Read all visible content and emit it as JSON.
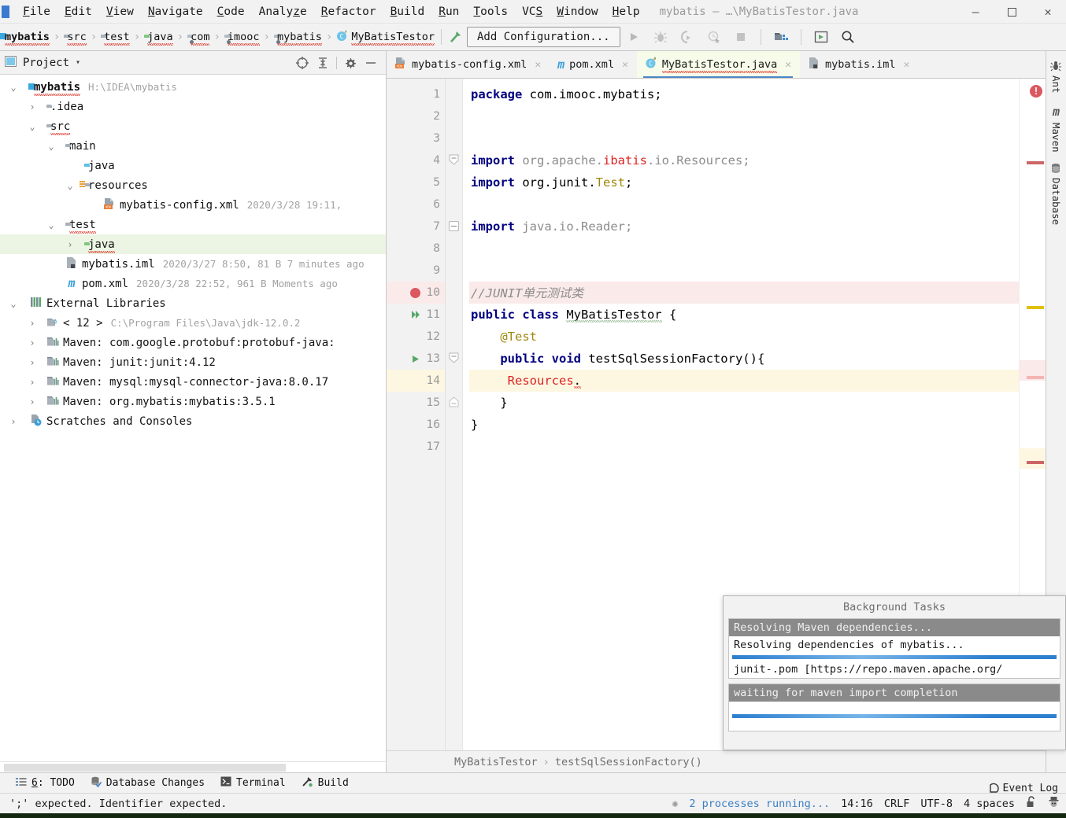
{
  "window": {
    "title": "mybatis – …\\MyBatisTestor.java",
    "minimize": "–",
    "maximize": "▢",
    "close": "✕"
  },
  "menubar": {
    "items": [
      {
        "label": "File",
        "mnemonic": "F"
      },
      {
        "label": "Edit",
        "mnemonic": "E"
      },
      {
        "label": "View",
        "mnemonic": "V"
      },
      {
        "label": "Navigate",
        "mnemonic": "N"
      },
      {
        "label": "Code",
        "mnemonic": "C"
      },
      {
        "label": "Analyze",
        "mnemonic": "z"
      },
      {
        "label": "Refactor",
        "mnemonic": "R"
      },
      {
        "label": "Build",
        "mnemonic": "B"
      },
      {
        "label": "Run",
        "mnemonic": "R"
      },
      {
        "label": "Tools",
        "mnemonic": "T"
      },
      {
        "label": "VCS",
        "mnemonic": "S"
      },
      {
        "label": "Window",
        "mnemonic": "W"
      },
      {
        "label": "Help",
        "mnemonic": "H"
      }
    ]
  },
  "navbar": {
    "breadcrumbs": [
      {
        "label": "mybatis",
        "icon": "module-folder-icon",
        "bold": true
      },
      {
        "label": "src",
        "icon": "folder-icon",
        "bold": false
      },
      {
        "label": "test",
        "icon": "folder-icon",
        "bold": false
      },
      {
        "label": "java",
        "icon": "source-folder-icon",
        "bold": false
      },
      {
        "label": "com",
        "icon": "package-icon",
        "bold": false
      },
      {
        "label": "imooc",
        "icon": "package-icon",
        "bold": false
      },
      {
        "label": "mybatis",
        "icon": "package-icon",
        "bold": false
      },
      {
        "label": "MyBatisTestor",
        "icon": "java-class-icon",
        "bold": false
      }
    ],
    "separator": "›",
    "add_configuration": "Add Configuration...",
    "buttons": [
      {
        "name": "build-hammer-icon",
        "title": "Build"
      },
      {
        "name": "run-icon",
        "title": "Run"
      },
      {
        "name": "debug-icon",
        "title": "Debug"
      },
      {
        "name": "run-with-coverage-icon",
        "title": "Run with Coverage"
      },
      {
        "name": "profile-icon",
        "title": "Profile"
      },
      {
        "name": "stop-icon",
        "title": "Stop"
      },
      {
        "name": "project-structure-icon",
        "title": "Project Structure"
      },
      {
        "name": "updates-icon",
        "title": "Updates"
      },
      {
        "name": "search-everywhere-icon",
        "title": "Search Everywhere"
      }
    ]
  },
  "project_panel": {
    "title": "Project",
    "caret": "▾",
    "tools": [
      {
        "name": "select-opened-file-icon"
      },
      {
        "name": "collapse-all-icon"
      },
      {
        "name": "settings-gear-icon"
      },
      {
        "name": "hide-icon"
      }
    ],
    "tree": [
      {
        "indent": 0,
        "arrow": "v",
        "icon": "module-folder-icon",
        "label": "mybatis",
        "bold": true,
        "meta": "H:\\IDEA\\mybatis",
        "selected": false,
        "squiggle": true
      },
      {
        "indent": 1,
        "arrow": ">",
        "icon": "folder-icon",
        "label": ".idea",
        "bold": false,
        "meta": "",
        "selected": false,
        "squiggle": false
      },
      {
        "indent": 1,
        "arrow": "v",
        "icon": "folder-icon",
        "label": "src",
        "bold": false,
        "meta": "",
        "selected": false,
        "squiggle": true
      },
      {
        "indent": 2,
        "arrow": "v",
        "icon": "folder-icon",
        "label": "main",
        "bold": false,
        "meta": "",
        "selected": false,
        "squiggle": false
      },
      {
        "indent": 3,
        "arrow": "",
        "icon": "source-folder-blue-icon",
        "label": "java",
        "bold": false,
        "meta": "",
        "selected": false,
        "squiggle": false
      },
      {
        "indent": 3,
        "arrow": "v",
        "icon": "resources-folder-icon",
        "label": "resources",
        "bold": false,
        "meta": "",
        "selected": false,
        "squiggle": false
      },
      {
        "indent": 4,
        "arrow": "",
        "icon": "xml-file-icon",
        "label": "mybatis-config.xml",
        "bold": false,
        "meta": "2020/3/28 19:11,",
        "selected": false,
        "squiggle": false
      },
      {
        "indent": 2,
        "arrow": "v",
        "icon": "folder-icon",
        "label": "test",
        "bold": false,
        "meta": "",
        "selected": false,
        "squiggle": true
      },
      {
        "indent": 3,
        "arrow": ">",
        "icon": "test-source-folder-icon",
        "label": "java",
        "bold": false,
        "meta": "",
        "selected": true,
        "squiggle": true
      },
      {
        "indent": 2,
        "arrow": "",
        "icon": "iml-file-icon",
        "label": "mybatis.iml",
        "bold": false,
        "meta": "2020/3/27 8:50, 81 B 7 minutes ago",
        "selected": false,
        "squiggle": false
      },
      {
        "indent": 2,
        "arrow": "",
        "icon": "maven-pom-icon",
        "label": "pom.xml",
        "bold": false,
        "meta": "2020/3/28 22:52, 961 B Moments ago",
        "selected": false,
        "squiggle": false
      },
      {
        "indent": 0,
        "arrow": "v",
        "icon": "external-libraries-icon",
        "label": "External Libraries",
        "bold": false,
        "meta": "",
        "selected": false,
        "squiggle": false
      },
      {
        "indent": 1,
        "arrow": ">",
        "icon": "jdk-icon",
        "label": "< 12 >",
        "bold": false,
        "meta": "C:\\Program Files\\Java\\jdk-12.0.2",
        "selected": false,
        "squiggle": false
      },
      {
        "indent": 1,
        "arrow": ">",
        "icon": "library-icon",
        "label": "Maven: com.google.protobuf:protobuf-java:",
        "bold": false,
        "meta": "",
        "selected": false,
        "squiggle": false
      },
      {
        "indent": 1,
        "arrow": ">",
        "icon": "library-icon",
        "label": "Maven: junit:junit:4.12",
        "bold": false,
        "meta": "",
        "selected": false,
        "squiggle": false
      },
      {
        "indent": 1,
        "arrow": ">",
        "icon": "library-icon",
        "label": "Maven: mysql:mysql-connector-java:8.0.17",
        "bold": false,
        "meta": "",
        "selected": false,
        "squiggle": false
      },
      {
        "indent": 1,
        "arrow": ">",
        "icon": "library-icon",
        "label": "Maven: org.mybatis:mybatis:3.5.1",
        "bold": false,
        "meta": "",
        "selected": false,
        "squiggle": false
      },
      {
        "indent": 0,
        "arrow": ">",
        "icon": "scratches-icon",
        "label": "Scratches and Consoles",
        "bold": false,
        "meta": "",
        "selected": false,
        "squiggle": false
      }
    ]
  },
  "editor": {
    "tabs": [
      {
        "label": "mybatis-config.xml",
        "icon": "xml-file-icon",
        "active": false,
        "close": "✕"
      },
      {
        "label": "pom.xml",
        "icon": "maven-pom-icon",
        "active": false,
        "close": "✕"
      },
      {
        "label": "MyBatisTestor.java",
        "icon": "java-class-icon",
        "active": true,
        "close": "✕"
      },
      {
        "label": "mybatis.iml",
        "icon": "iml-file-icon",
        "active": false,
        "close": "✕"
      }
    ],
    "lines": [
      {
        "n": 1,
        "state": "",
        "gutter": "",
        "fold": "",
        "tokens": [
          {
            "t": "package",
            "c": "kw"
          },
          {
            "t": " ",
            "c": "pl"
          },
          {
            "t": "com.imooc.mybatis;",
            "c": "pl"
          }
        ]
      },
      {
        "n": 2,
        "state": "",
        "gutter": "",
        "fold": "",
        "tokens": []
      },
      {
        "n": 3,
        "state": "",
        "gutter": "",
        "fold": "",
        "tokens": []
      },
      {
        "n": 4,
        "state": "",
        "gutter": "",
        "fold": "fold-down",
        "tokens": [
          {
            "t": "import",
            "c": "kw"
          },
          {
            "t": " ",
            "c": "pl"
          },
          {
            "t": "org.apache.",
            "c": "gray"
          },
          {
            "t": "ibatis",
            "c": "red"
          },
          {
            "t": ".io.Resources;",
            "c": "gray"
          }
        ]
      },
      {
        "n": 5,
        "state": "",
        "gutter": "",
        "fold": "",
        "tokens": [
          {
            "t": "import",
            "c": "kw"
          },
          {
            "t": " ",
            "c": "pl"
          },
          {
            "t": "org.junit.",
            "c": "pl"
          },
          {
            "t": "Test",
            "c": "annot"
          },
          {
            "t": ";",
            "c": "pl"
          }
        ]
      },
      {
        "n": 6,
        "state": "",
        "gutter": "",
        "fold": "",
        "tokens": []
      },
      {
        "n": 7,
        "state": "",
        "gutter": "",
        "fold": "fold-minus",
        "tokens": [
          {
            "t": "import",
            "c": "kw"
          },
          {
            "t": " ",
            "c": "pl"
          },
          {
            "t": "java.io.Reader;",
            "c": "gray"
          }
        ]
      },
      {
        "n": 8,
        "state": "",
        "gutter": "",
        "fold": "",
        "tokens": []
      },
      {
        "n": 9,
        "state": "",
        "gutter": "",
        "fold": "",
        "tokens": []
      },
      {
        "n": 10,
        "state": "err",
        "gutter": "breakpoint",
        "fold": "",
        "tokens": [
          {
            "t": "//JUNIT单元测试类",
            "c": "cmt"
          }
        ]
      },
      {
        "n": 11,
        "state": "",
        "gutter": "run-all",
        "fold": "",
        "tokens": [
          {
            "t": "public",
            "c": "kw"
          },
          {
            "t": " ",
            "c": "pl"
          },
          {
            "t": "class",
            "c": "kw"
          },
          {
            "t": " ",
            "c": "pl"
          },
          {
            "t": "MyBatisTestor",
            "c": "clserr"
          },
          {
            "t": " {",
            "c": "pl"
          }
        ]
      },
      {
        "n": 12,
        "state": "",
        "gutter": "",
        "fold": "",
        "tokens": [
          {
            "t": "    ",
            "c": "pl"
          },
          {
            "t": "@Test",
            "c": "annot"
          }
        ]
      },
      {
        "n": 13,
        "state": "",
        "gutter": "run",
        "fold": "fold-minus",
        "tokens": [
          {
            "t": "    ",
            "c": "pl"
          },
          {
            "t": "public",
            "c": "kw"
          },
          {
            "t": " ",
            "c": "pl"
          },
          {
            "t": "void",
            "c": "kw"
          },
          {
            "t": " testSqlSessionFactory(){",
            "c": "pl"
          }
        ]
      },
      {
        "n": 14,
        "state": "hl",
        "gutter": "",
        "fold": "",
        "tokens": [
          {
            "t": "     ",
            "c": "pl"
          },
          {
            "t": "Resources",
            "c": "red"
          },
          {
            "t": ".",
            "c": "dotwarn"
          }
        ]
      },
      {
        "n": 15,
        "state": "",
        "gutter": "",
        "fold": "fold-minus",
        "tokens": [
          {
            "t": "    }",
            "c": "pl"
          }
        ]
      },
      {
        "n": 16,
        "state": "",
        "gutter": "",
        "fold": "",
        "tokens": [
          {
            "t": "}",
            "c": "pl"
          }
        ]
      },
      {
        "n": 17,
        "state": "",
        "gutter": "",
        "fold": "",
        "tokens": []
      }
    ],
    "breadcrumb": {
      "class": "MyBatisTestor",
      "separator": "›",
      "method": "testSqlSessionFactory()"
    },
    "error_icon": "!"
  },
  "right_strip": {
    "tabs": [
      {
        "label": "Ant",
        "icon": "ant-icon"
      },
      {
        "label": "Maven",
        "icon": "maven-icon"
      },
      {
        "label": "Database",
        "icon": "database-icon"
      }
    ]
  },
  "background_tasks": {
    "title": "Background Tasks",
    "tasks": [
      {
        "head": "Resolving Maven dependencies...",
        "sub": "Resolving dependencies of mybatis...",
        "progress": 100,
        "detail": "junit-.pom [https://repo.maven.apache.org/"
      },
      {
        "head": "waiting for maven import completion",
        "sub": "",
        "progress": 100,
        "detail": ""
      }
    ]
  },
  "toolwindow_bar": {
    "items": [
      {
        "label": "6: TODO",
        "mnemonic": "6",
        "icon": "todo-icon"
      },
      {
        "label": "Database Changes",
        "mnemonic": "",
        "icon": "database-changes-icon"
      },
      {
        "label": "Terminal",
        "mnemonic": "",
        "icon": "terminal-icon"
      },
      {
        "label": "Build",
        "mnemonic": "",
        "icon": "build-hammer-icon"
      }
    ]
  },
  "statusbar": {
    "message": "';' expected. Identifier expected.",
    "processes": "2 processes running...",
    "time": "14:16",
    "line_separator": "CRLF",
    "encoding": "UTF-8",
    "indent": "4 spaces",
    "lock_icon": "lock-open-icon",
    "inspector_icon": "hector-icon",
    "event_log": "Event Log"
  },
  "colors": {
    "accent": "#3b7fc4",
    "selection": "#ecf5e3",
    "active_tab": "#f7fbe9",
    "error": "#db5860",
    "warn_line": "#fdf7e2",
    "error_line": "#fbeaea",
    "keyword": "#000080",
    "string_red": "#dd2222",
    "bottom_edge": "#14280f"
  }
}
